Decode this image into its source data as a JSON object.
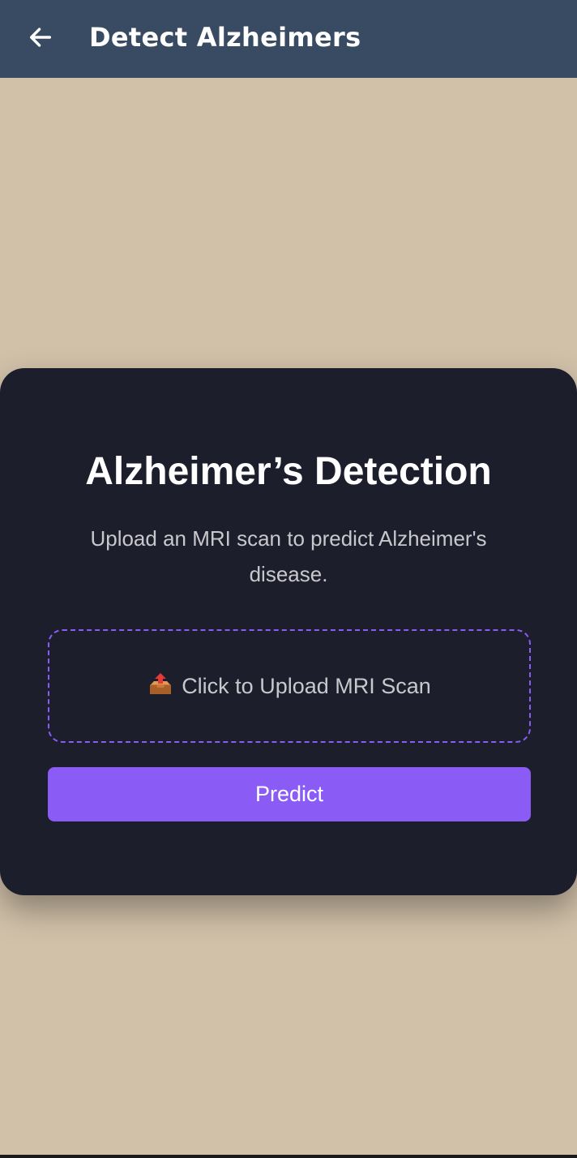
{
  "app_bar": {
    "title": "Detect Alzheimers",
    "back_icon": "arrow-left-icon"
  },
  "card": {
    "title": "Alzheimer’s Detection",
    "subtitle": "Upload an MRI scan to predict Alzheimer's disease.",
    "upload": {
      "icon": "outbox-tray-icon",
      "label": "Click to Upload MRI Scan"
    },
    "predict_label": "Predict"
  },
  "colors": {
    "app_bar": "#384b63",
    "background": "#d1c1a9",
    "card": "#1d1e2c",
    "accent": "#8a5cf5"
  }
}
